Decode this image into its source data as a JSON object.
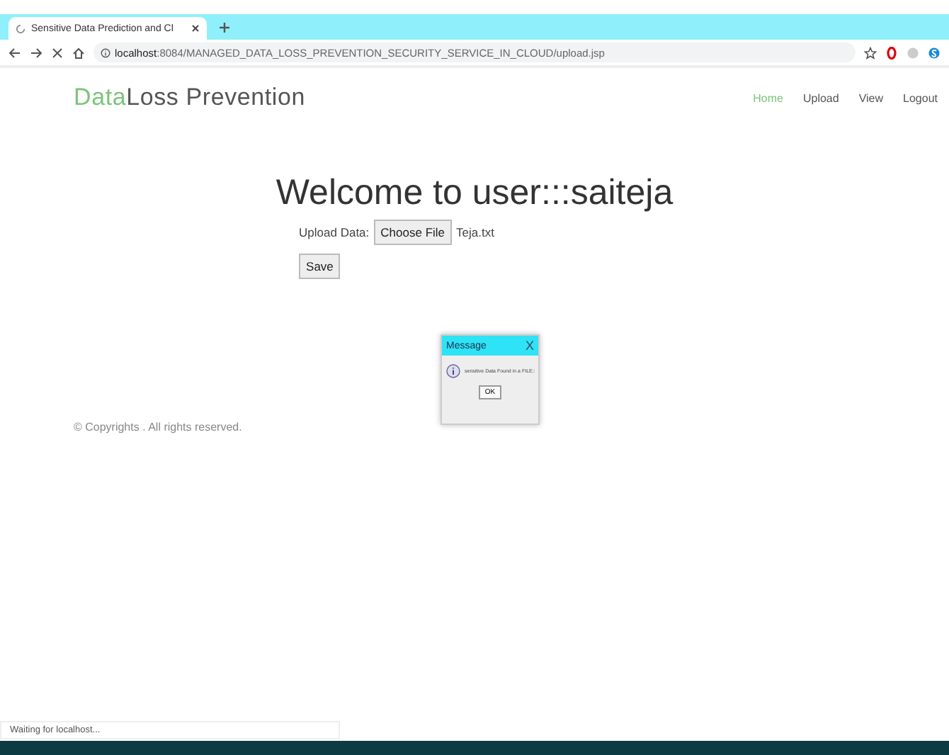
{
  "browser": {
    "tabs": [
      {
        "title": "Sensitive Data Prediction and Cl",
        "loading": true,
        "selected": true
      }
    ],
    "address": {
      "host": "localhost",
      "rest": ":8084/MANAGED_DATA_LOSS_PREVENTION_SECURITY_SERVICE_IN_CLOUD/upload.jsp"
    }
  },
  "site": {
    "logo": {
      "accent": "Data",
      "rest": "Loss Prevention"
    },
    "nav": [
      {
        "label": "Home",
        "selected": true
      },
      {
        "label": "Upload",
        "selected": false
      },
      {
        "label": "View",
        "selected": false
      },
      {
        "label": "Logout",
        "selected": false
      }
    ],
    "heading": "Welcome to user:::saiteja",
    "upload": {
      "label": "Upload Data:",
      "button": "Choose File",
      "file": "Teja.txt"
    },
    "save": "Save",
    "footer": "© Copyrights . All rights reserved."
  },
  "dialog": {
    "title": "Message",
    "close": "X",
    "message": "sensitive Data Found in a FILE::",
    "ok": "OK"
  },
  "status_bar": "Waiting for localhost..."
}
